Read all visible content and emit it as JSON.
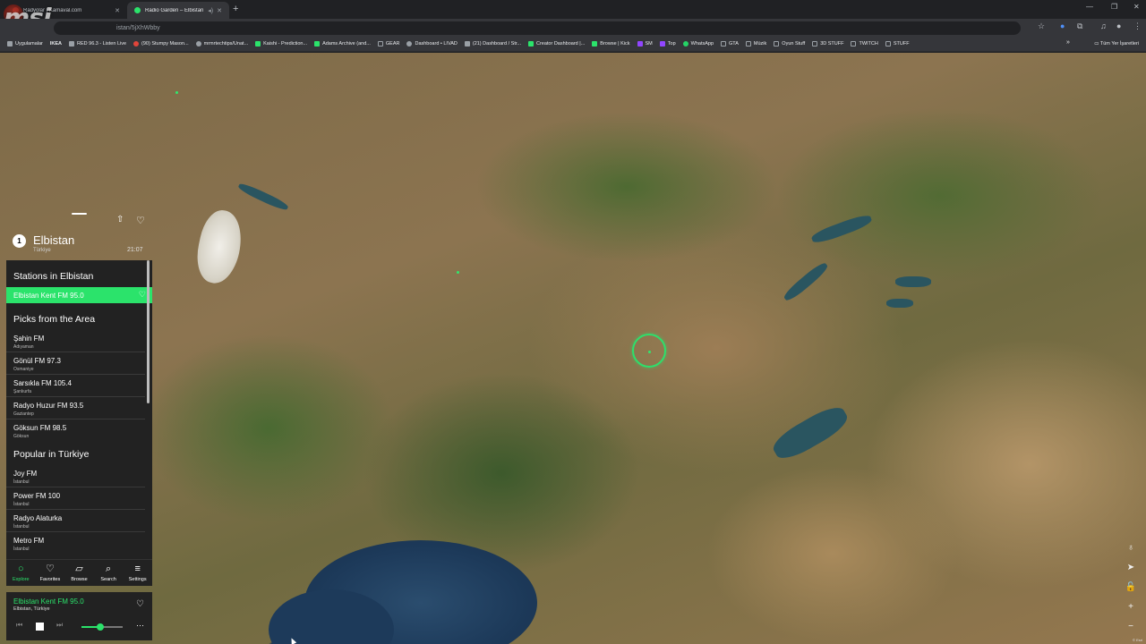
{
  "browser": {
    "tabs": [
      {
        "title": "Radyolar | Kamaval.com",
        "active": false,
        "favicon_color": "#e0453a"
      },
      {
        "title": "Radio Garden – Elbistan",
        "active": true,
        "favicon_color": "#2be36b"
      }
    ],
    "address": "istan/5jXhWbby",
    "bookmarks": [
      "Uygulamalar",
      "IKEA",
      "RED 96.3 - Listen Live",
      "(90) Stumpy Mason...",
      "mrmrtechtips/Unat...",
      "Kaishi - Prediction...",
      "Adams Archive (and...",
      "GEAR",
      "Dashboard • LIVAD",
      "(21) Dashboard / Str...",
      "Creator Dashboard |...",
      "Browse | Kick",
      "SM",
      "Top",
      "WhatsApp",
      "GTA",
      "Müzik",
      "Oyun Stuff",
      "3D STUFF",
      "TWITCH",
      "STUFF"
    ],
    "bookmarks_right": "Tüm Yer İşaretleri",
    "overlay_logo": "msi"
  },
  "place": {
    "number": "1",
    "name": "Elbistan",
    "country": "Türkiye",
    "time": "21:07"
  },
  "stations_section": {
    "title": "Stations in Elbistan",
    "items": [
      {
        "name": "Elbistan Kent FM 95.0",
        "active": true
      }
    ]
  },
  "picks_section": {
    "title": "Picks from the Area",
    "items": [
      {
        "name": "Şahin FM",
        "city": "Adıyaman"
      },
      {
        "name": "Gönül FM 97.3",
        "city": "Osmaniye"
      },
      {
        "name": "Sarsıkla FM 105.4",
        "city": "Şanlıurfa"
      },
      {
        "name": "Radyo Huzur FM 93.5",
        "city": "Gaziantep"
      },
      {
        "name": "Göksun FM 98.5",
        "city": "Göksun"
      }
    ]
  },
  "popular_section": {
    "title": "Popular in Türkiye",
    "items": [
      {
        "name": "Joy FM",
        "city": "İstanbul"
      },
      {
        "name": "Power FM 100",
        "city": "İstanbul"
      },
      {
        "name": "Radyo Alaturka",
        "city": "İstanbul"
      },
      {
        "name": "Metro FM",
        "city": "İstanbul"
      }
    ]
  },
  "nav": [
    {
      "label": "Explore",
      "icon": "explore-icon",
      "active": true
    },
    {
      "label": "Favorites",
      "icon": "heart-icon",
      "active": false
    },
    {
      "label": "Browse",
      "icon": "map-icon",
      "active": false
    },
    {
      "label": "Search",
      "icon": "search-icon",
      "active": false
    },
    {
      "label": "Settings",
      "icon": "menu-icon",
      "active": false
    }
  ],
  "player": {
    "station": "Elbistan Kent FM 95.0",
    "place": "Elbistan, Türkiye",
    "volume": 0.45
  },
  "colors": {
    "accent": "#2be36b",
    "panel": "#222222"
  }
}
